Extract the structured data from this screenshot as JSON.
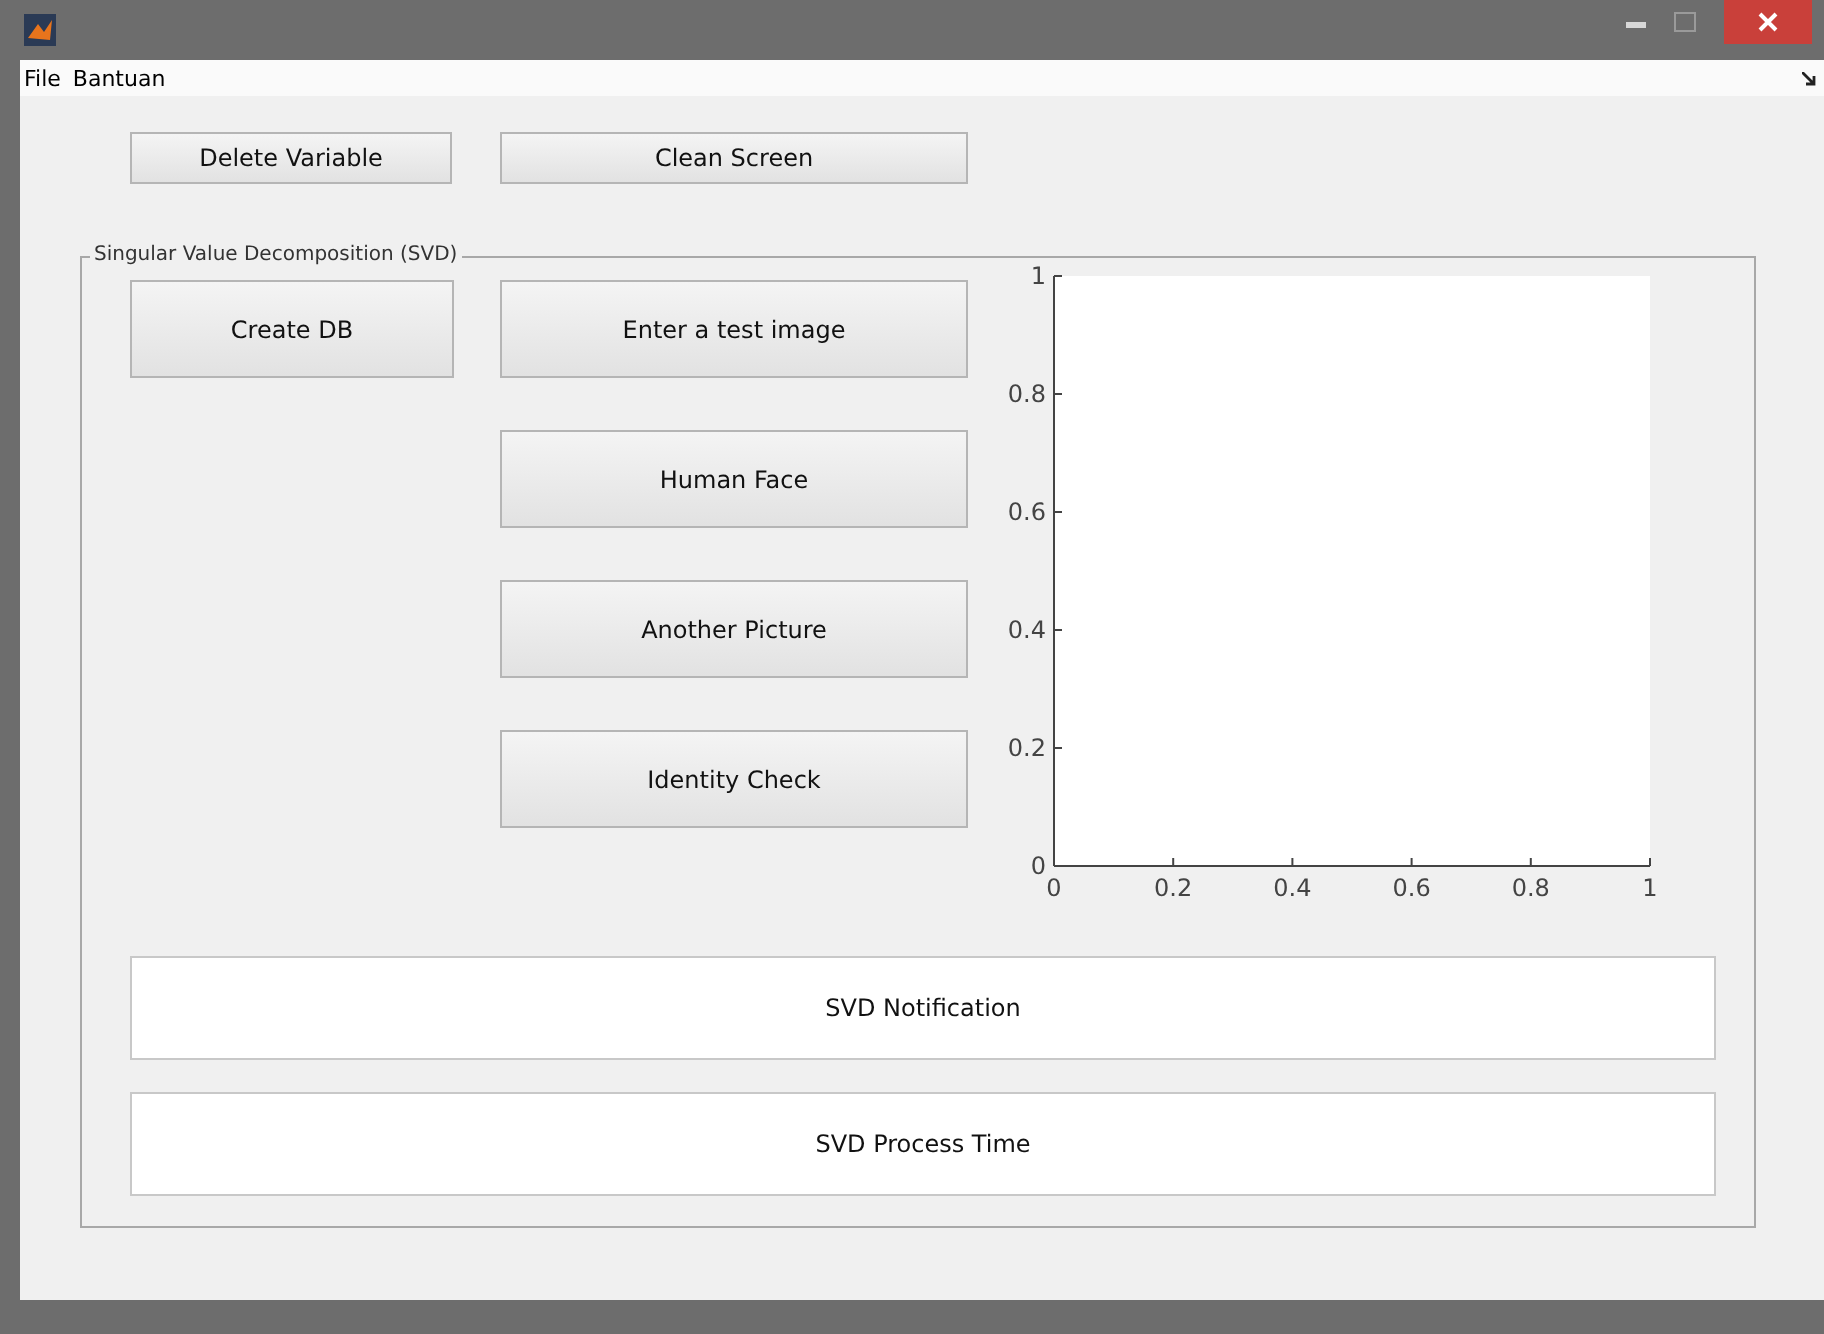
{
  "menu": [
    {
      "label": "File"
    },
    {
      "label": "Bantuan"
    }
  ],
  "top_buttons": [
    {
      "label": "Delete Variable"
    },
    {
      "label": "Clean Screen"
    }
  ],
  "panel": {
    "title": "Singular Value Decomposition (SVD)",
    "left_buttons": [
      {
        "label": "Create DB"
      }
    ],
    "buttons": [
      {
        "label": "Enter a test image"
      },
      {
        "label": "Human Face"
      },
      {
        "label": "Another Picture"
      },
      {
        "label": "Identity Check"
      }
    ],
    "axes": {
      "chart_data": {
        "type": "line",
        "xlim": [
          0,
          1
        ],
        "ylim": [
          0,
          1
        ],
        "xticks": [
          {
            "value": 0,
            "label": "0"
          },
          {
            "value": 0.2,
            "label": "0.2"
          },
          {
            "value": 0.4,
            "label": "0.4"
          },
          {
            "value": 0.6,
            "label": "0.6"
          },
          {
            "value": 0.8,
            "label": "0.8"
          },
          {
            "value": 1,
            "label": "1"
          }
        ],
        "yticks": [
          {
            "value": 0,
            "label": "0"
          },
          {
            "value": 0.2,
            "label": "0.2"
          },
          {
            "value": 0.4,
            "label": "0.4"
          },
          {
            "value": 0.6,
            "label": "0.6"
          },
          {
            "value": 0.8,
            "label": "0.8"
          },
          {
            "value": 1,
            "label": "1"
          }
        ]
      }
    },
    "text_boxes": [
      {
        "value": "SVD Notification"
      },
      {
        "value": "SVD Process Time"
      }
    ]
  }
}
